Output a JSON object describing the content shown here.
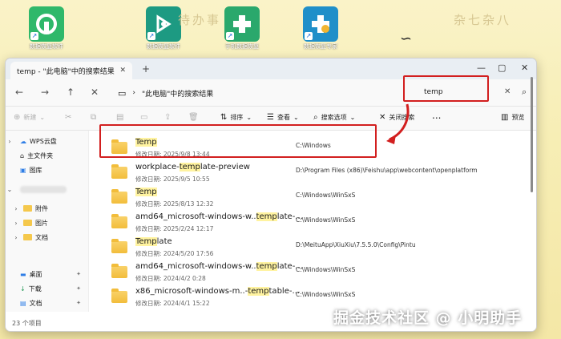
{
  "desktop": {
    "icons": [
      {
        "caption": "数据恢复软件"
      },
      {
        "caption": "数据恢复软件"
      },
      {
        "caption": "手机数据恢复"
      },
      {
        "caption": "数据恢复专家"
      }
    ],
    "banner_left": "待办事",
    "banner_right": "杂七杂八"
  },
  "window": {
    "tab_title": "temp - \"此电脑\"中的搜索结果",
    "nav": {
      "breadcrumb": "\"此电脑\"中的搜索结果",
      "search_value": "temp"
    },
    "toolbar": {
      "new": "新建",
      "sort": "排序",
      "view": "查看",
      "search_options": "搜索选项",
      "close_search": "关闭搜索",
      "more": "...",
      "preview": "预览"
    },
    "sidebar": {
      "items": [
        {
          "label": "WPS云盘"
        },
        {
          "label": "主文件夹"
        },
        {
          "label": "图库"
        },
        {
          "label": "附件"
        },
        {
          "label": "图片"
        },
        {
          "label": "文档"
        },
        {
          "label": "桌面"
        },
        {
          "label": "下载"
        },
        {
          "label": "文档"
        }
      ]
    },
    "status": "23 个项目",
    "results": [
      {
        "name_pre": "",
        "name_hl": "Temp",
        "name_post": "",
        "date": "修改日期: 2025/9/8 13:44",
        "path": "C:\\Windows"
      },
      {
        "name_pre": "workplace-",
        "name_hl": "temp",
        "name_post": "late-preview",
        "date": "修改日期: 2025/9/5 10:55",
        "path": "D:\\Program Files (x86)\\Feishu\\app\\webcontent\\openplatform"
      },
      {
        "name_pre": "",
        "name_hl": "Temp",
        "name_post": "",
        "date": "修改日期: 2025/8/13 12:32",
        "path": "C:\\Windows\\WinSxS"
      },
      {
        "name_pre": "amd64_microsoft-windows-w..",
        "name_hl": "temp",
        "name_post": "late-...",
        "date": "修改日期: 2025/2/24 12:17",
        "path": "C:\\Windows\\WinSxS"
      },
      {
        "name_pre": "",
        "name_hl": "Temp",
        "name_post": "late",
        "date": "修改日期: 2024/5/20 17:56",
        "path": "D:\\MeituApp\\XiuXiu\\7.5.5.0\\Config\\Pintu"
      },
      {
        "name_pre": "amd64_microsoft-windows-w..",
        "name_hl": "temp",
        "name_post": "late-...",
        "date": "修改日期: 2024/4/2 0:28",
        "path": "C:\\Windows\\WinSxS"
      },
      {
        "name_pre": "x86_microsoft-windows-m..-",
        "name_hl": "temp",
        "name_post": "table-...",
        "date": "修改日期: 2024/4/1 15:22",
        "path": "C:\\Windows\\WinSxS"
      }
    ]
  },
  "watermark": "掘金技术社区 @ 小明助手",
  "colors": {
    "highlight_box": "#d21f1f",
    "match_highlight": "#fff3a0",
    "folder": "#f5c84c"
  }
}
